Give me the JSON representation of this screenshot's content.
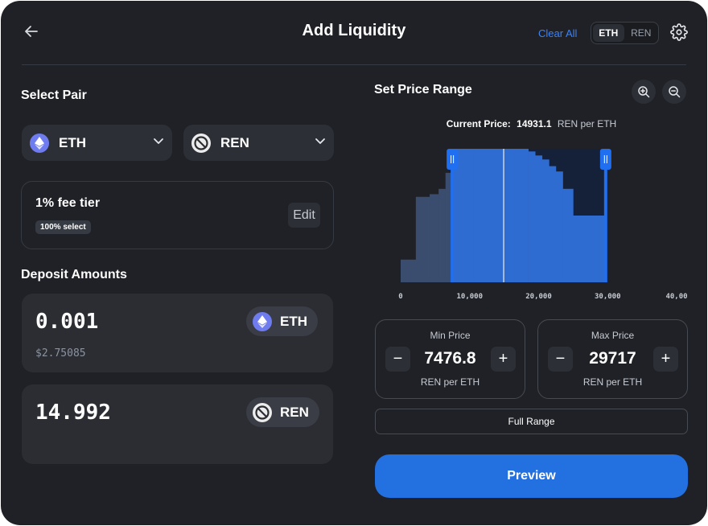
{
  "header": {
    "title": "Add Liquidity",
    "clear_all": "Clear All",
    "toggle": [
      "ETH",
      "REN"
    ],
    "toggle_active": "ETH"
  },
  "select_pair": {
    "title": "Select Pair",
    "token_a": "ETH",
    "token_b": "REN"
  },
  "fee": {
    "label": "1% fee tier",
    "badge": "100% select",
    "edit": "Edit"
  },
  "deposit": {
    "title": "Deposit Amounts",
    "token_a": {
      "amount": "0.001",
      "usd": "$2.75085",
      "symbol": "ETH"
    },
    "token_b": {
      "amount": "14.992",
      "symbol": "REN"
    }
  },
  "range": {
    "title": "Set Price Range",
    "current_price_label": "Current Price:",
    "current_price_value": "14931.1",
    "current_price_unit": "REN per ETH",
    "min_label": "Min Price",
    "min_value": "7476.8",
    "max_label": "Max Price",
    "max_value": "29717",
    "unit": "REN per ETH",
    "full_range": "Full Range"
  },
  "chart_data": {
    "type": "bar",
    "x_ticks": [
      "0",
      "10,000",
      "20,000",
      "30,000",
      "40,00"
    ],
    "xlim": [
      0,
      40000
    ],
    "current_price": 14931.1,
    "selected_range": [
      7476.8,
      29717
    ],
    "bars": [
      {
        "x0": 0,
        "x1": 2200,
        "level": 0.17
      },
      {
        "x0": 2200,
        "x1": 4200,
        "level": 0.64
      },
      {
        "x0": 4200,
        "x1": 5500,
        "level": 0.66
      },
      {
        "x0": 5500,
        "x1": 6500,
        "level": 0.7
      },
      {
        "x0": 6500,
        "x1": 7500,
        "level": 0.82
      },
      {
        "x0": 7500,
        "x1": 10500,
        "level": 1.0
      },
      {
        "x0": 10500,
        "x1": 18500,
        "level": 1.0
      },
      {
        "x0": 18500,
        "x1": 19500,
        "level": 0.98
      },
      {
        "x0": 19500,
        "x1": 20500,
        "level": 0.95
      },
      {
        "x0": 20500,
        "x1": 21500,
        "level": 0.92
      },
      {
        "x0": 21500,
        "x1": 22500,
        "level": 0.87
      },
      {
        "x0": 22500,
        "x1": 23500,
        "level": 0.83
      },
      {
        "x0": 23500,
        "x1": 25000,
        "level": 0.7
      },
      {
        "x0": 25000,
        "x1": 28500,
        "level": 0.5
      },
      {
        "x0": 28500,
        "x1": 29717,
        "level": 0.5
      }
    ],
    "colors": {
      "in_range": "#2f6cd1",
      "out_range": "#3a4d6e",
      "band": "#152138",
      "handle": "#1f6ff0",
      "current_line": "#c9d4e6"
    }
  },
  "preview": "Preview",
  "colors": {
    "accent": "#2370e0",
    "link": "#3b82f6",
    "background": "#1f2126"
  },
  "icons": {
    "back": "arrow-left-icon",
    "settings": "gear-icon",
    "zoom_in": "zoom-in-icon",
    "zoom_out": "zoom-out-icon"
  }
}
